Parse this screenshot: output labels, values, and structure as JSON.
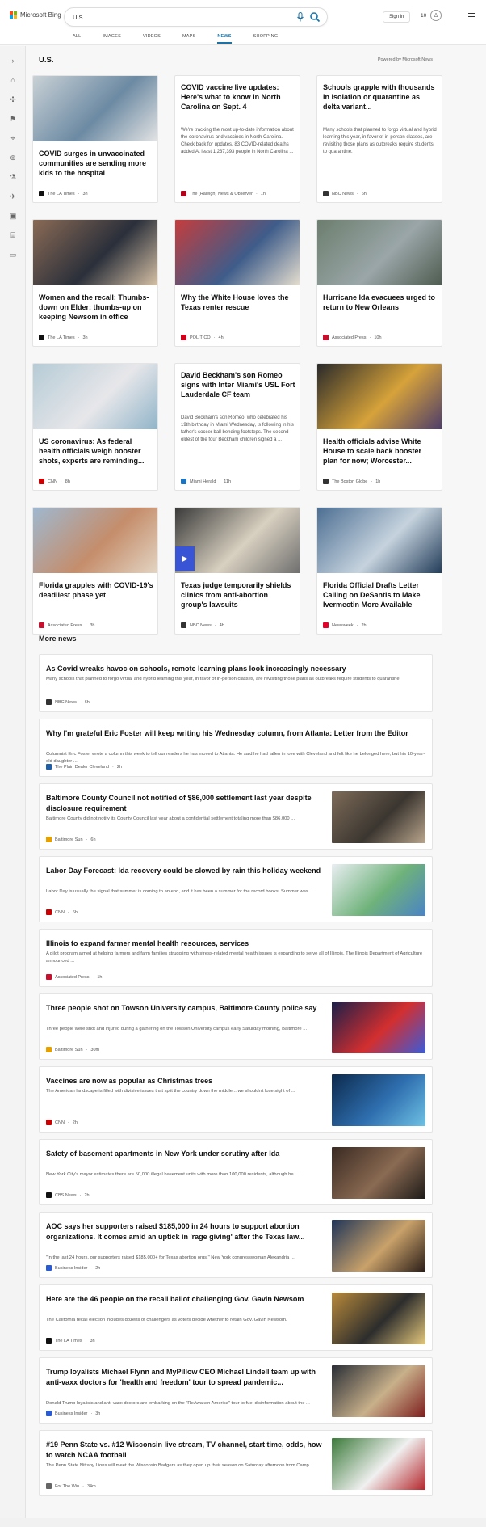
{
  "header": {
    "brand": "Microsoft Bing",
    "search_value": "U.S.",
    "signin": "Sign in",
    "points": "10",
    "scopes": [
      "ALL",
      "IMAGES",
      "VIDEOS",
      "MAPS",
      "NEWS",
      "SHOPPING"
    ],
    "active_scope": "NEWS"
  },
  "section": {
    "title": "U.S.",
    "powered_by": "Powered by Microsoft News"
  },
  "cards": [
    {
      "title": "COVID surges in unvaccinated communities are sending more kids to the hospital",
      "source": "The LA Times",
      "time": "3h",
      "has_image": true,
      "img_colors": [
        "#c9d1d6",
        "#6c8aa3",
        "#e5e5e5"
      ],
      "src_color": "#111"
    },
    {
      "title": "COVID vaccine live updates: Here's what to know in North Carolina on Sept. 4",
      "snippet": "We're tracking the most up-to-date information about the coronavirus and vaccines in North Carolina. Check back for updates. 83 COVID-related deaths added At least 1,237,393 people in North Carolina ...",
      "source": "The (Raleigh) News & Observer",
      "time": "1h",
      "has_image": false,
      "src_color": "#b3001b"
    },
    {
      "title": "Schools grapple with thousands in isolation or quarantine as delta variant...",
      "snippet": "Many schools that planned to forgo virtual and hybrid learning this year, in favor of in-person classes, are revisiting those plans as outbreaks require students to quarantine.",
      "source": "NBC News",
      "time": "6h",
      "has_image": false,
      "src_color": "#333"
    },
    {
      "title": "Women and the recall: Thumbs-down on Elder; thumbs-up on keeping Newsom in office",
      "source": "The LA Times",
      "time": "3h",
      "has_image": true,
      "img_colors": [
        "#8a6a55",
        "#2a2f3a",
        "#d9c3a7"
      ],
      "src_color": "#111"
    },
    {
      "title": "Why the White House loves the Texas renter rescue",
      "source": "POLITICO",
      "time": "4h",
      "has_image": true,
      "img_colors": [
        "#c43d3d",
        "#3e5c8a",
        "#e8e0d0"
      ],
      "src_color": "#d0021b"
    },
    {
      "title": "Hurricane Ida evacuees urged to return to New Orleans",
      "source": "Associated Press",
      "time": "10h",
      "has_image": true,
      "img_colors": [
        "#6c7e6e",
        "#9aa6a8",
        "#4d5b4f"
      ],
      "src_color": "#c8102e"
    },
    {
      "title": "US coronavirus: As federal health officials weigh booster shots, experts are reminding...",
      "source": "CNN",
      "time": "8h",
      "has_image": true,
      "img_colors": [
        "#b6cbd6",
        "#e7e7ea",
        "#8fb3c8"
      ],
      "src_color": "#cc0000"
    },
    {
      "title": "David Beckham's son Romeo signs with Inter Miami's USL Fort Lauderdale CF team",
      "snippet": "David Beckham's son Romeo, who celebrated his 19th birthday in Miami Wednesday, is following in his father's soccer ball bending footsteps. The second oldest of the four Beckham children signed a ...",
      "source": "Miami Herald",
      "time": "11h",
      "has_image": false,
      "src_color": "#1e73be"
    },
    {
      "title": "Health officials advise White House to scale back booster plan for now; Worcester...",
      "source": "The Boston Globe",
      "time": "1h",
      "has_image": true,
      "img_colors": [
        "#2a2a2a",
        "#d6a23a",
        "#4b3b6a"
      ],
      "src_color": "#333"
    },
    {
      "title": "Florida grapples with COVID-19's deadliest phase yet",
      "source": "Associated Press",
      "time": "3h",
      "has_image": true,
      "img_colors": [
        "#9fb8cf",
        "#c58d6b",
        "#e3d6c5"
      ],
      "src_color": "#c8102e"
    },
    {
      "title": "Texas judge temporarily shields clinics from anti-abortion group's lawsuits",
      "source": "NBC News",
      "time": "4h",
      "has_image": true,
      "img_colors": [
        "#3a3a3a",
        "#d8d0c0",
        "#6e6e6e"
      ],
      "src_color": "#333",
      "video": true
    },
    {
      "title": "Florida Official Drafts Letter Calling on DeSantis to Make Ivermectin More Available",
      "source": "Newsweek",
      "time": "2h",
      "has_image": true,
      "img_colors": [
        "#4d6f93",
        "#c6d3de",
        "#203a57"
      ],
      "src_color": "#e4002b"
    }
  ],
  "more_news_title": "More news",
  "more_news": [
    {
      "title": "As Covid wreaks havoc on schools, remote learning plans look increasingly necessary",
      "snippet": "Many schools that planned to forgo virtual and hybrid learning this year, in favor of in-person classes, are revisiting those plans as outbreaks require students to quarantine.",
      "source": "NBC News",
      "time": "6h",
      "has_image": false,
      "src_color": "#333"
    },
    {
      "title": "Why I'm grateful Eric Foster will keep writing his Wednesday column, from Atlanta: Letter from the Editor",
      "snippet": "Columnist Eric Foster wrote a column this week to tell our readers he has moved to Atlanta. He said he had fallen in love with Cleveland and felt like he belonged here, but his 10-year-old daughter ...",
      "source": "The Plain Dealer Cleveland",
      "time": "2h",
      "has_image": false,
      "src_color": "#1f5fa8"
    },
    {
      "title": "Baltimore County Council not notified of $86,000 settlement last year despite disclosure requirement",
      "snippet": "Baltimore County did not notify its County Council last year about a confidential settlement totaling more than $86,000 ...",
      "source": "Baltimore Sun",
      "time": "6h",
      "has_image": true,
      "img_colors": [
        "#7d6b58",
        "#3b3630",
        "#b9a58c"
      ],
      "src_color": "#e6a100"
    },
    {
      "title": "Labor Day Forecast: Ida recovery could be slowed by rain this holiday weekend",
      "snippet": "Labor Day is usually the signal that summer is coming to an end, and it has been a summer for the record books. Summer was ...",
      "source": "CNN",
      "time": "6h",
      "has_image": true,
      "img_colors": [
        "#e9eef2",
        "#6fb27a",
        "#4a83c5"
      ],
      "src_color": "#cc0000"
    },
    {
      "title": "Illinois to expand farmer mental health resources, services",
      "snippet": "A pilot program aimed at helping farmers and farm families struggling with stress-related mental health issues is expanding to serve all of Illinois. The Illinois Department of Agriculture announced ...",
      "source": "Associated Press",
      "time": "1h",
      "has_image": false,
      "src_color": "#c8102e"
    },
    {
      "title": "Three people shot on Towson University campus, Baltimore County police say",
      "snippet": "Three people were shot and injured during a gathering on the Towson University campus early Saturday morning, Baltimore ...",
      "source": "Baltimore Sun",
      "time": "30m",
      "has_image": true,
      "img_colors": [
        "#1a1f4a",
        "#d32f2f",
        "#3a5bd9"
      ],
      "src_color": "#e6a100"
    },
    {
      "title": "Vaccines are now as popular as Christmas trees",
      "snippet": "The American landscape is filled with divisive issues that split the country down the middle... we shouldn't lose sight of ...",
      "source": "CNN",
      "time": "2h",
      "has_image": true,
      "img_colors": [
        "#0c2a4d",
        "#2f6fb0",
        "#6ec1e4"
      ],
      "src_color": "#cc0000"
    },
    {
      "title": "Safety of basement apartments in New York under scrutiny after Ida",
      "snippet": "New York City's mayor estimates there are 50,000 illegal basement units with more than 100,000 residents, although he ...",
      "source": "CBS News",
      "time": "2h",
      "has_image": true,
      "img_colors": [
        "#3a2a22",
        "#8a6a52",
        "#1d1a18"
      ],
      "src_color": "#111"
    },
    {
      "title": "AOC says her supporters raised $185,000 in 24 hours to support abortion organizations. It comes amid an uptick in 'rage giving' after the Texas law...",
      "snippet": "\"In the last 24 hours, our supporters raised $185,000+ for Texas abortion orgs,\" New York congresswoman Alexandria ...",
      "source": "Business Insider",
      "time": "2h",
      "has_image": true,
      "img_colors": [
        "#1f3558",
        "#c9a16a",
        "#2a1d18"
      ],
      "src_color": "#2a5bd7"
    },
    {
      "title": "Here are the 46 people on the recall ballot challenging Gov. Gavin Newsom",
      "snippet": "The California recall election includes dozens of challengers as voters decide whether to retain Gov. Gavin Newsom.",
      "source": "The LA Times",
      "time": "3h",
      "has_image": true,
      "img_colors": [
        "#b98a3a",
        "#2d2d2d",
        "#e3c77b"
      ],
      "src_color": "#111"
    },
    {
      "title": "Trump loyalists Michael Flynn and MyPillow CEO Michael Lindell team up with anti-vaxx doctors for 'health and freedom' tour to spread pandemic...",
      "snippet": "Donald Trump loyalists and anti-vaxx doctors are embarking on the \"ReAwaken America\" tour to fuel disinformation about the ...",
      "source": "Business Insider",
      "time": "3h",
      "has_image": true,
      "img_colors": [
        "#2a2e36",
        "#c8b08a",
        "#7d1d1d"
      ],
      "src_color": "#2a5bd7"
    },
    {
      "title": "#19 Penn State vs. #12 Wisconsin live stream, TV channel, start time, odds, how to watch NCAA football",
      "snippet": "The Penn State Nittany Lions will meet the Wisconsin Badgers as they open up their season on Saturday afternoon from Camp ...",
      "source": "For The Win",
      "time": "34m",
      "has_image": true,
      "img_colors": [
        "#3b7a3a",
        "#f0f0f0",
        "#b3262b"
      ],
      "src_color": "#666"
    }
  ],
  "footer": "",
  "rail_icons": [
    "expand-icon",
    "home-icon",
    "pin-icon",
    "flag-icon",
    "location-icon",
    "globe-icon",
    "science-icon",
    "space-icon",
    "video-icon",
    "bank-icon",
    "card-icon"
  ]
}
